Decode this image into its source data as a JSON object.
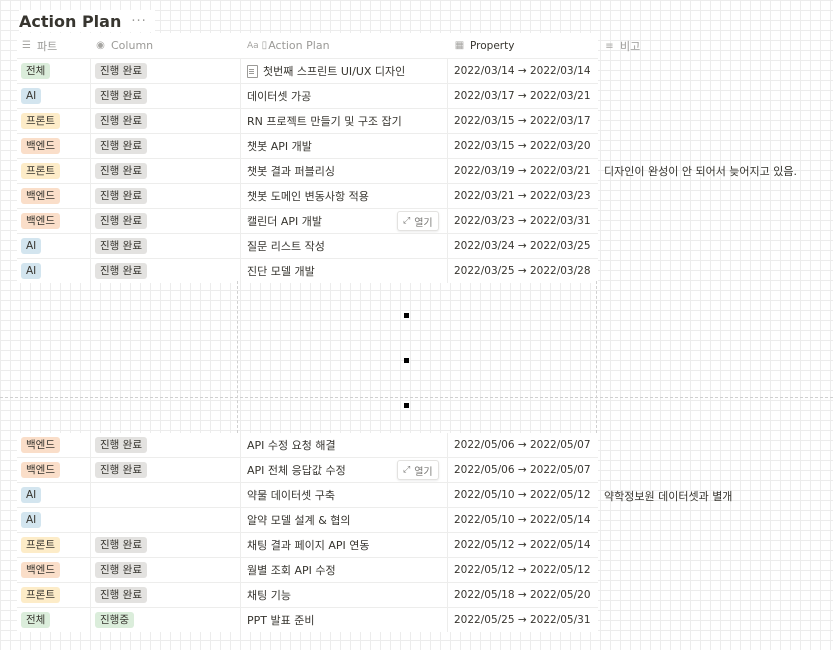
{
  "page": {
    "title": "Action Plan",
    "more": "···"
  },
  "columns": {
    "c1": {
      "label": "파트",
      "icon": "list-icon"
    },
    "c2": {
      "label": "Column",
      "icon": "status-icon"
    },
    "c3": {
      "label": "Action Plan",
      "icon": "title-icon",
      "prefix": "Aa"
    },
    "c4": {
      "label": "Property",
      "icon": "calendar-icon"
    },
    "c5": {
      "label": "비고",
      "icon": "text-icon"
    }
  },
  "open_label": "열기",
  "rows_top": [
    {
      "part": "전체",
      "status": "진행 완료",
      "task": "첫번째 스프린트 UI/UX 디자인",
      "date": "2022/03/14 → 2022/03/14",
      "note": "",
      "doc": true
    },
    {
      "part": "AI",
      "status": "진행 완료",
      "task": "데이터셋 가공",
      "date": "2022/03/17 → 2022/03/21",
      "note": ""
    },
    {
      "part": "프론트",
      "status": "진행 완료",
      "task": "RN 프로젝트 만들기 및 구조 잡기",
      "date": "2022/03/15 → 2022/03/17",
      "note": ""
    },
    {
      "part": "백엔드",
      "status": "진행 완료",
      "task": "챗봇 API 개발",
      "date": "2022/03/15 → 2022/03/20",
      "note": ""
    },
    {
      "part": "프론트",
      "status": "진행 완료",
      "task": "챗봇 결과 퍼블리싱",
      "date": "2022/03/19 → 2022/03/21",
      "note": "디자인이 완성이 안 되어서 늦어지고 있음."
    },
    {
      "part": "백엔드",
      "status": "진행 완료",
      "task": "챗봇 도메인 변동사항 적용",
      "date": "2022/03/21 → 2022/03/23",
      "note": ""
    },
    {
      "part": "백엔드",
      "status": "진행 완료",
      "task": "캘린더 API 개발",
      "date": "2022/03/23 → 2022/03/31",
      "note": "",
      "open": true
    },
    {
      "part": "AI",
      "status": "진행 완료",
      "task": "질문 리스트 작성",
      "date": "2022/03/24 → 2022/03/25",
      "note": ""
    },
    {
      "part": "AI",
      "status": "진행 완료",
      "task": "진단 모델 개발",
      "date": "2022/03/25 → 2022/03/28",
      "note": ""
    }
  ],
  "rows_bottom": [
    {
      "part": "백엔드",
      "status": "진행 완료",
      "task": "API 수정 요청 해결",
      "date": "2022/05/06 → 2022/05/07",
      "note": ""
    },
    {
      "part": "백엔드",
      "status": "진행 완료",
      "task": "API 전체 응답값 수정",
      "date": "2022/05/06 → 2022/05/07",
      "note": "",
      "open": true
    },
    {
      "part": "AI",
      "status": "",
      "task": "약물 데이터셋 구축",
      "date": "2022/05/10 → 2022/05/12",
      "note": "약학정보원 데이터셋과 별개"
    },
    {
      "part": "AI",
      "status": "",
      "task": "알약 모델 설계 & 협의",
      "date": "2022/05/10 → 2022/05/14",
      "note": ""
    },
    {
      "part": "프론트",
      "status": "진행 완료",
      "task": "채팅 결과 페이지 API 연동",
      "date": "2022/05/12 → 2022/05/14",
      "note": ""
    },
    {
      "part": "백엔드",
      "status": "진행 완료",
      "task": "월별 조회 API 수정",
      "date": "2022/05/12 → 2022/05/12",
      "note": ""
    },
    {
      "part": "프론트",
      "status": "진행 완료",
      "task": "채팅 기능",
      "date": "2022/05/18 → 2022/05/20",
      "note": ""
    },
    {
      "part": "전체",
      "status": "진행중",
      "task": "PPT 발표 준비",
      "date": "2022/05/25 → 2022/05/31",
      "note": ""
    }
  ],
  "tag_colors": {
    "전체": "#dbeddb",
    "AI": "#d3e5ef",
    "프론트": "#fdecc8",
    "백엔드": "#fadec9",
    "진행 완료": "#e3e2e0",
    "진행중": "#dbeddb"
  }
}
